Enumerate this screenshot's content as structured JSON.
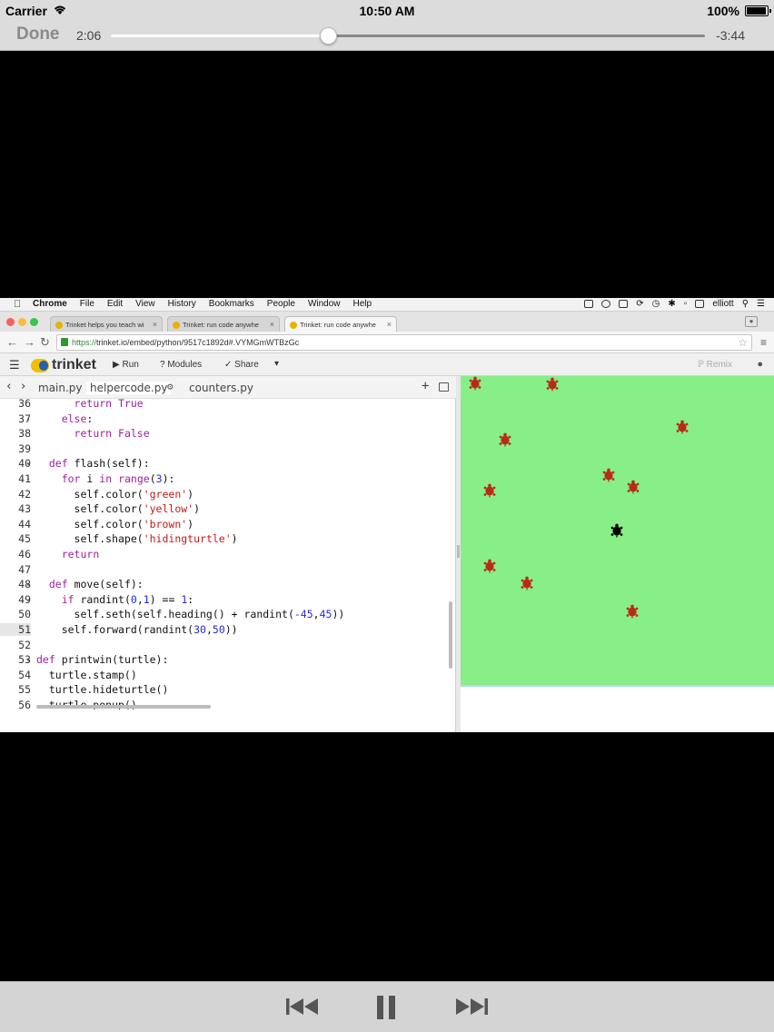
{
  "status_bar": {
    "carrier": "Carrier",
    "time": "10:50 AM",
    "battery": "100%"
  },
  "player": {
    "done_label": "Done",
    "elapsed": "2:06",
    "remaining": "-3:44",
    "progress": 0.3655
  },
  "mac_menu": {
    "items": [
      "Chrome",
      "File",
      "Edit",
      "View",
      "History",
      "Bookmarks",
      "People",
      "Window",
      "Help"
    ],
    "user": "elliott"
  },
  "browser": {
    "tabs": [
      {
        "label": "Trinket helps you teach wi"
      },
      {
        "label": "Trinket: run code anywhe"
      },
      {
        "label": "Trinket: run code anywhe"
      }
    ],
    "url_scheme": "https://",
    "url_rest": "trinket.io/embed/python/9517c1892d#.VYMGmWTBzGc"
  },
  "trinket": {
    "logo": "trinket",
    "run": "Run",
    "modules": "Modules",
    "share": "Share",
    "remix": "Remix"
  },
  "editor": {
    "files": [
      "main.py",
      "helpercode.py",
      "counters.py"
    ],
    "lines": [
      {
        "n": "36",
        "fold": false,
        "html": "      <span class=\"kw\">return</span> <span class=\"kw\">True</span>"
      },
      {
        "n": "37",
        "fold": true,
        "html": "    <span class=\"kw\">else</span>:"
      },
      {
        "n": "38",
        "fold": false,
        "html": "      <span class=\"kw\">return</span> <span class=\"kw\">False</span>"
      },
      {
        "n": "39",
        "fold": false,
        "html": ""
      },
      {
        "n": "40",
        "fold": true,
        "html": "  <span class=\"kw\">def</span> flash(self):"
      },
      {
        "n": "41",
        "fold": true,
        "html": "    <span class=\"kw\">for</span> i <span class=\"kw\">in</span> <span class=\"kw\">range</span>(<span class=\"num\">3</span>):"
      },
      {
        "n": "42",
        "fold": false,
        "html": "      self.color(<span class=\"str\">'green'</span>)"
      },
      {
        "n": "43",
        "fold": false,
        "html": "      self.color(<span class=\"str\">'yellow'</span>)"
      },
      {
        "n": "44",
        "fold": false,
        "html": "      self.color(<span class=\"str\">'brown'</span>)"
      },
      {
        "n": "45",
        "fold": false,
        "html": "      self.shape(<span class=\"str\">'hidingturtle'</span>)"
      },
      {
        "n": "46",
        "fold": false,
        "html": "    <span class=\"kw\">return</span>"
      },
      {
        "n": "47",
        "fold": false,
        "html": ""
      },
      {
        "n": "48",
        "fold": true,
        "html": "  <span class=\"kw\">def</span> move(self):"
      },
      {
        "n": "49",
        "fold": true,
        "html": "    <span class=\"kw\">if</span> randint(<span class=\"num\">0</span>,<span class=\"num\">1</span>) == <span class=\"num\">1</span>:"
      },
      {
        "n": "50",
        "fold": false,
        "html": "      self.seth(self.heading() + randint(<span class=\"num\">-45</span>,<span class=\"num\">45</span>))"
      },
      {
        "n": "51",
        "fold": false,
        "html": "    self.forward(randint(<span class=\"num\">30</span>,<span class=\"num\">50</span>))",
        "current": true
      },
      {
        "n": "52",
        "fold": false,
        "html": ""
      },
      {
        "n": "53",
        "fold": true,
        "html": "<span class=\"kw\">def</span> printwin(turtle):"
      },
      {
        "n": "54",
        "fold": false,
        "html": "  turtle.stamp()"
      },
      {
        "n": "55",
        "fold": false,
        "html": "  turtle.hideturtle()"
      },
      {
        "n": "56",
        "fold": false,
        "html": "  turtle.penup()"
      }
    ]
  },
  "canvas": {
    "bg": "#88ee88",
    "turtle_color": "#b82a1a",
    "player_color": "#000000"
  }
}
